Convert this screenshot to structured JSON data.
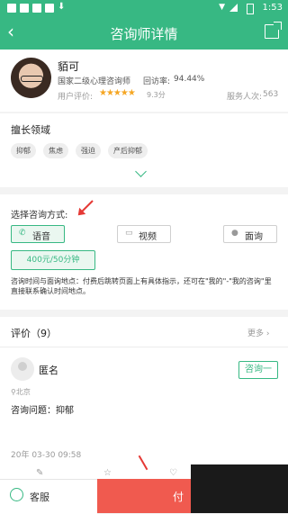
{
  "status_bar": {
    "time": "1:53"
  },
  "header": {
    "title": "咨询师详情"
  },
  "profile": {
    "name": "貊可",
    "qualification": "国家二级心理咨询师",
    "visit_rate_label": "回访率:",
    "visit_rate": "94.44%",
    "user_rating_label": "用户评价:",
    "stars": "★★★★★",
    "score": "9.3分",
    "served_label": "服务人次:",
    "served_count": "563"
  },
  "expertise": {
    "title": "擅长领域",
    "tags": [
      "抑郁",
      "焦虑",
      "强迫",
      "产后抑郁"
    ]
  },
  "consult": {
    "title": "选择咨询方式:",
    "methods": [
      "语音",
      "视频",
      "面询"
    ],
    "price": "400元/50分钟",
    "note": "咨询时间与面询地点：付费后跳转页面上有具体指示，还可在\"我的\"-\"我的咨询\"里直接联系确认时间地点。"
  },
  "reviews": {
    "title": "评价（9）",
    "more": "更多",
    "item": {
      "name": "匿名",
      "button": "咨询一",
      "location": "北京",
      "issue": "咨询问题：抑郁",
      "date": "20年 03-30 09:58"
    }
  },
  "bottom": {
    "service": "客服",
    "buy": "付"
  },
  "colors": {
    "brand": "#37b883",
    "cta": "#f05a4f",
    "star": "#f5a623"
  }
}
